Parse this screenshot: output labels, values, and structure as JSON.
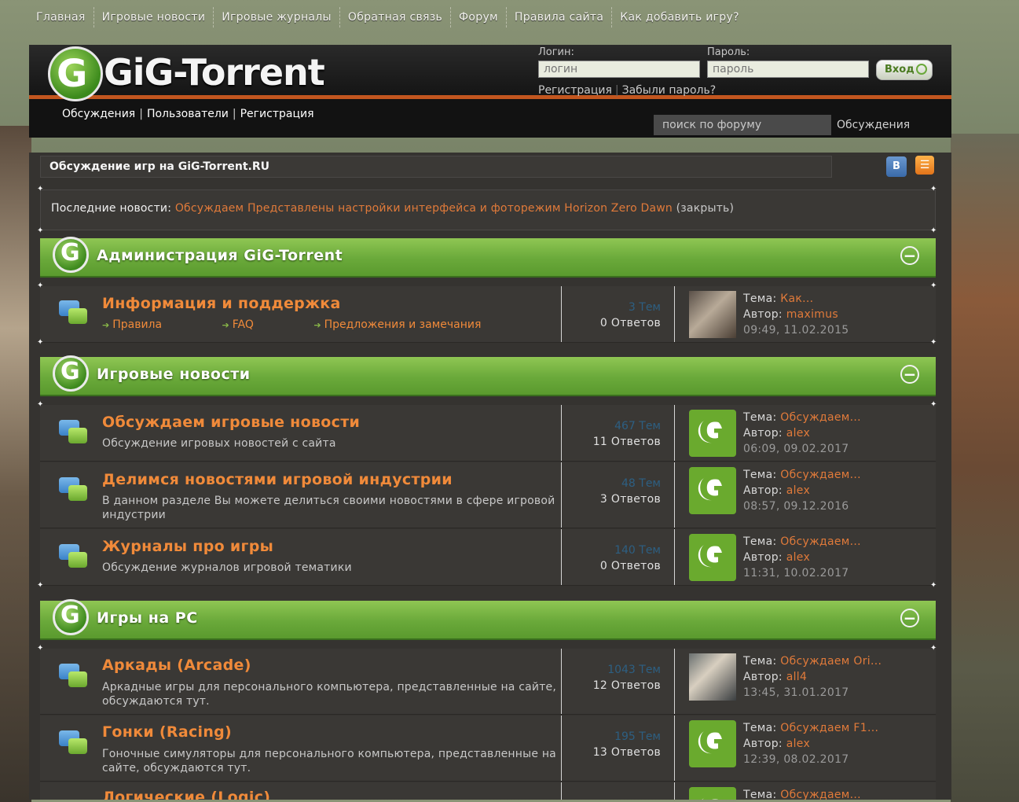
{
  "topnav": [
    "Главная",
    "Игровые новости",
    "Игровые журналы",
    "Обратная связь",
    "Форум",
    "Правила сайта",
    "Как добавить игру?"
  ],
  "header": {
    "logo_text": "GiG-Torrent",
    "login_label": "Логин:",
    "login_placeholder": "логин",
    "password_label": "Пароль:",
    "password_placeholder": "пароль",
    "login_button": "Вход",
    "register_link": "Регистрация",
    "forgot_link": "Забыли пароль?",
    "subnav": [
      "Обсуждения",
      "Пользователи",
      "Регистрация"
    ],
    "search_placeholder": "поиск по форуму",
    "search_scope": "Обсуждения"
  },
  "page": {
    "title": "Обсуждение игр на GiG-Torrent.RU",
    "news_label": "Последние новости:",
    "news_link": "Обсуждаем Представлены настройки интерфейса и фоторежим Horizon Zero Dawn",
    "news_close": "(закрыть)"
  },
  "categories": [
    {
      "title": "Администрация GiG-Torrent"
    },
    {
      "title": "Игровые новости"
    },
    {
      "title": "Игры на PC"
    }
  ],
  "forums": [
    {
      "name": "Информация и поддержка",
      "subforums": [
        "Правила",
        "FAQ",
        "Предложения и замечания"
      ],
      "topics": "3 Тем",
      "posts": "0 Ответов",
      "last_topic": "Как...",
      "last_author": "maximus",
      "last_date": "09:49, 11.02.2015"
    },
    {
      "name": "Обсуждаем игровые новости",
      "desc": "Обсуждение игровых новостей с сайта",
      "topics": "467 Тем",
      "posts": "11 Ответов",
      "last_topic": "Обсуждаем...",
      "last_author": "alex",
      "last_date": "06:09, 09.02.2017"
    },
    {
      "name": "Делимся новостями игровой индустрии",
      "desc": "В данном разделе Вы можете делиться своими новостями в сфере игровой индустрии",
      "topics": "48 Тем",
      "posts": "3 Ответов",
      "last_topic": "Обсуждаем...",
      "last_author": "alex",
      "last_date": "08:57, 09.12.2016"
    },
    {
      "name": "Журналы про игры",
      "desc": "Обсуждение журналов игровой тематики",
      "topics": "140 Тем",
      "posts": "0 Ответов",
      "last_topic": "Обсуждаем...",
      "last_author": "alex",
      "last_date": "11:31, 10.02.2017"
    },
    {
      "name": "Аркады (Arcade)",
      "desc": "Аркадные игры для персонального компьютера, представленные на сайте, обсуждаются тут.",
      "topics": "1043 Тем",
      "posts": "12 Ответов",
      "last_topic": "Обсуждаем Ori...",
      "last_author": "all4",
      "last_date": "13:45, 31.01.2017"
    },
    {
      "name": "Гонки (Racing)",
      "desc": "Гоночные симуляторы для персонального компьютера, представленные на сайте, обсуждаются тут.",
      "topics": "195 Тем",
      "posts": "13 Ответов",
      "last_topic": "Обсуждаем F1...",
      "last_author": "alex",
      "last_date": "12:39, 08.02.2017"
    },
    {
      "name": "Логические (Logic)",
      "last_topic": "Обсуждаем..."
    }
  ],
  "labels": {
    "topic": "Тема: ",
    "author": "Автор: "
  }
}
